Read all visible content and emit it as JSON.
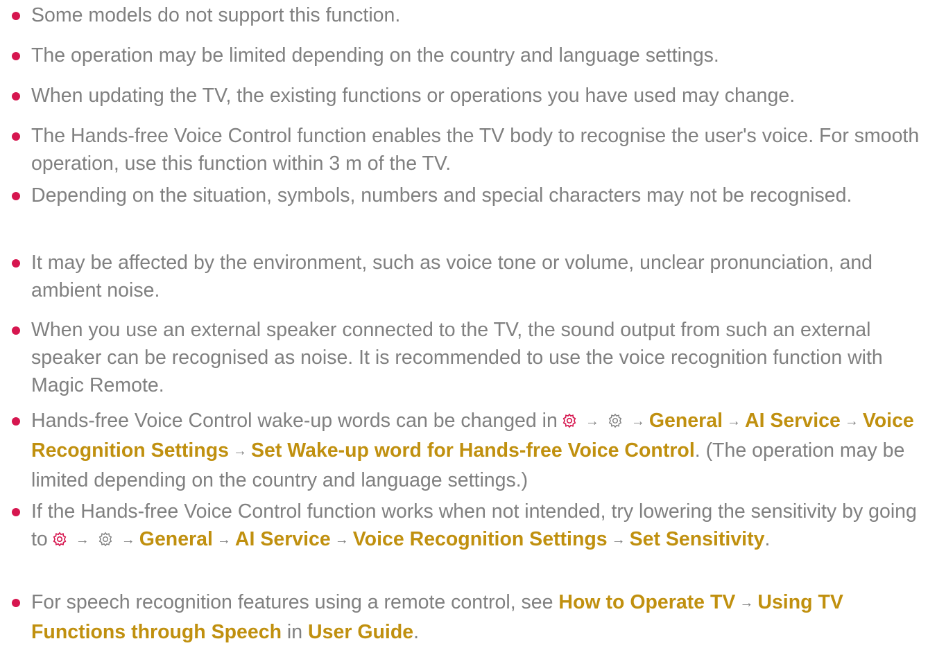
{
  "notes": [
    {
      "text": "Some models do not support this function."
    },
    {
      "text": "The operation may be limited depending on the country and language settings."
    },
    {
      "text": "When updating the TV, the existing functions or operations you have used may change."
    },
    {
      "text": "The Hands-free Voice Control function enables the TV body to recognise the user's voice. For smooth operation, use this function within 3 m of the TV."
    },
    {
      "text": "Depending on the situation, symbols, numbers and special characters may not be recognised."
    },
    {
      "text": "It may be affected by the environment, such as voice tone or volume, unclear pronunciation, and ambient noise."
    },
    {
      "text": "When you use an external speaker connected to the TV, the sound output from such an external speaker can be recognised as noise. It is recommended to use the voice recognition function with Magic Remote."
    },
    {
      "lead": "Hands-free Voice Control wake-up words can be changed in",
      "path": [
        "General",
        "AI Service",
        "Voice Recognition Settings",
        "Set Wake-up word for Hands-free Voice Control"
      ],
      "tail": ". (The operation may be limited depending on the country and language settings.)"
    },
    {
      "lead": "If the Hands-free Voice Control function works when not intended, try lowering the sensitivity by going to",
      "path": [
        "General",
        "AI Service",
        "Voice Recognition Settings",
        "Set Sensitivity"
      ],
      "tail": "."
    },
    {
      "lead": "For speech recognition features using a remote control, see",
      "path": [
        "How to Operate TV",
        "Using TV Functions through Speech"
      ],
      "mid": "in",
      "guide": "User Guide",
      "tail": "."
    }
  ],
  "icons": {
    "settings_red": "settings-gear-icon",
    "settings_gray": "all-settings-gear-icon",
    "arrow": "→"
  },
  "colors": {
    "text": "#808080",
    "highlight": "#c0900f",
    "bullet": "#d6164f"
  }
}
